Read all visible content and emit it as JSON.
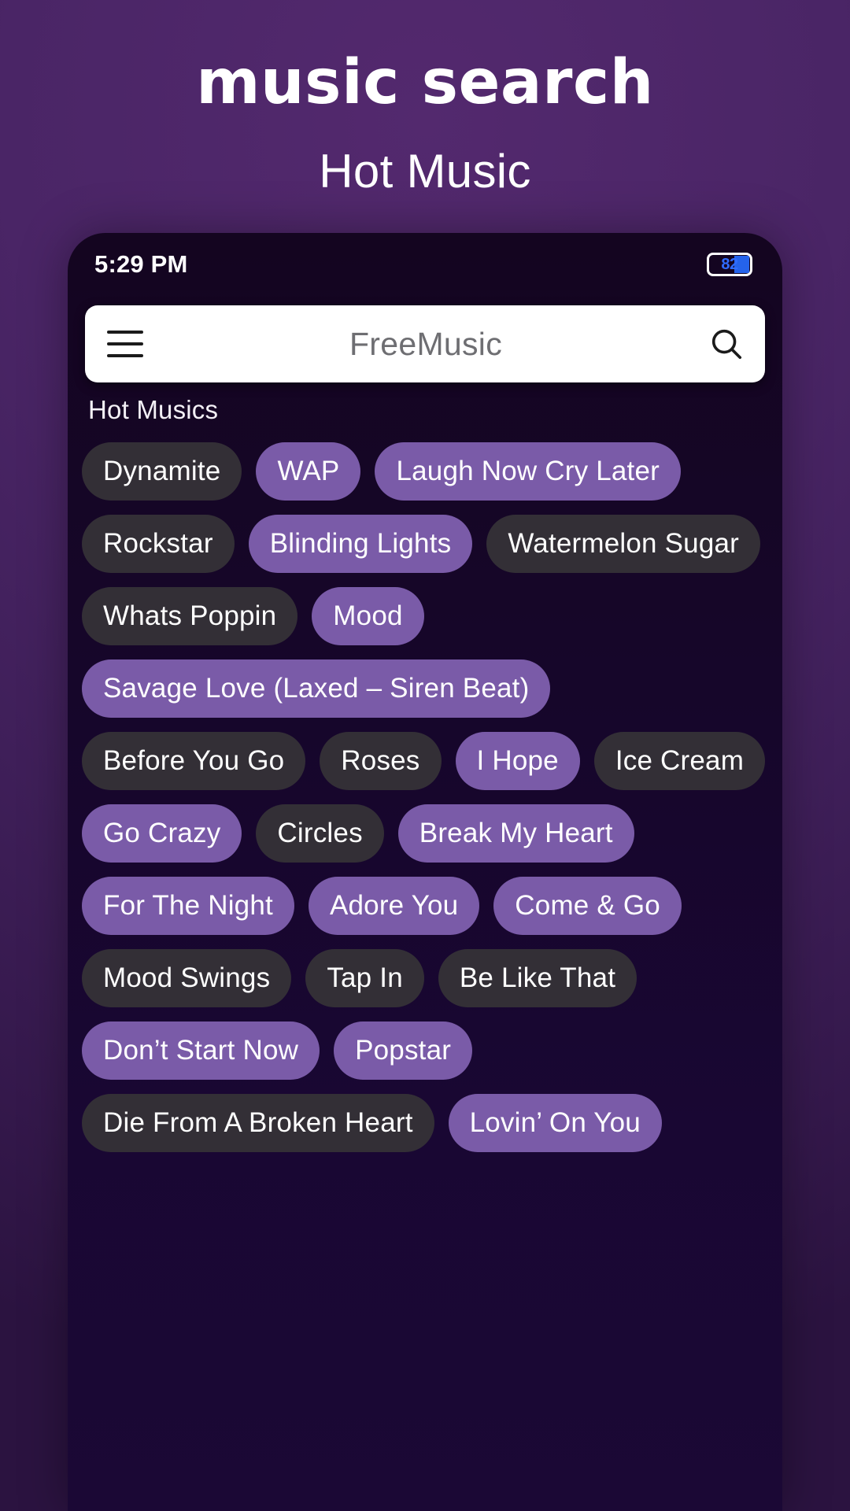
{
  "promo": {
    "title": "music search",
    "subtitle": "Hot Music"
  },
  "phone": {
    "statusbar": {
      "time": "5:29 PM",
      "battery_percent": "82",
      "battery_icon": "battery-icon"
    },
    "searchbar": {
      "menu_icon": "hamburger-menu-icon",
      "app_title": "FreeMusic",
      "search_icon": "search-icon"
    },
    "section": {
      "label": "Hot Musics"
    },
    "chips": [
      {
        "label": "Dynamite",
        "style": "dark"
      },
      {
        "label": "WAP",
        "style": "purple"
      },
      {
        "label": "Laugh Now Cry Later",
        "style": "purple"
      },
      {
        "label": "Rockstar",
        "style": "dark"
      },
      {
        "label": "Blinding Lights",
        "style": "purple"
      },
      {
        "label": "Watermelon Sugar",
        "style": "dark"
      },
      {
        "label": "Whats Poppin",
        "style": "dark"
      },
      {
        "label": "Mood",
        "style": "purple"
      },
      {
        "label": "Savage Love (Laxed – Siren Beat)",
        "style": "purple"
      },
      {
        "label": "Before You Go",
        "style": "dark"
      },
      {
        "label": "Roses",
        "style": "dark"
      },
      {
        "label": "I Hope",
        "style": "purple"
      },
      {
        "label": "Ice Cream",
        "style": "dark"
      },
      {
        "label": "Go Crazy",
        "style": "purple"
      },
      {
        "label": "Circles",
        "style": "dark"
      },
      {
        "label": "Break My Heart",
        "style": "purple"
      },
      {
        "label": "For The Night",
        "style": "purple"
      },
      {
        "label": "Adore You",
        "style": "purple"
      },
      {
        "label": "Come & Go",
        "style": "purple"
      },
      {
        "label": "Mood Swings",
        "style": "dark"
      },
      {
        "label": "Tap In",
        "style": "dark"
      },
      {
        "label": "Be Like That",
        "style": "dark"
      },
      {
        "label": "Don’t Start Now",
        "style": "purple"
      },
      {
        "label": "Popstar",
        "style": "purple"
      },
      {
        "label": "Die From A Broken Heart",
        "style": "dark"
      },
      {
        "label": "Lovin’ On You",
        "style": "purple"
      }
    ]
  },
  "colors": {
    "background_purple": "#4a2566",
    "phone_background": "#16062a",
    "chip_dark": "#332f36",
    "chip_purple": "#7a5ba8",
    "searchbar_background": "#ffffff",
    "battery_fill": "#2563eb"
  }
}
